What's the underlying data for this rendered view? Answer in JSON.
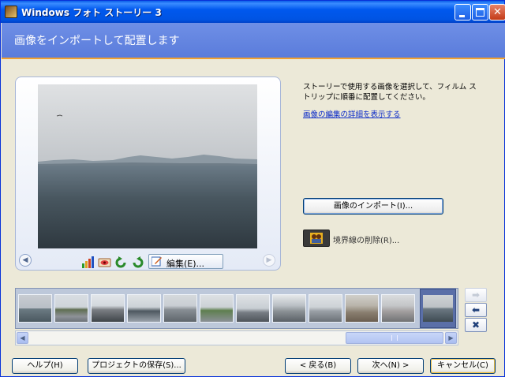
{
  "window": {
    "title": "Windows フォト ストーリー 3"
  },
  "header": {
    "title": "画像をインポートして配置します"
  },
  "preview": {
    "nav_left": "◀",
    "nav_right": "▶",
    "edit_label": "編集(E)..."
  },
  "right_pane": {
    "instruction": "ストーリーで使用する画像を選択して、フィルム ストリップに順番に配置してください。",
    "details_link": "画像の編集の詳細を表示する",
    "import_button": "画像のインポート(I)...",
    "remove_borders": "境界線の削除(R)..."
  },
  "filmstrip": {
    "thumbnails": [
      "photo-1",
      "photo-2",
      "photo-3",
      "photo-4",
      "photo-5",
      "photo-6",
      "photo-7",
      "photo-8",
      "photo-9",
      "photo-10",
      "photo-11",
      "photo-12",
      "photo-13"
    ],
    "selected_index": 12,
    "side_buttons": {
      "right": "➡",
      "left": "⬅",
      "remove": "✖"
    }
  },
  "footer": {
    "help": "ヘルプ(H)",
    "save_project": "プロジェクトの保存(S)...",
    "back": "< 戻る(B)",
    "next": "次へ(N) >",
    "cancel": "キャンセル(C)"
  },
  "colors": {
    "titlebar": "#0054e3",
    "header": "#6484dd",
    "accent_line": "#f0a032",
    "link": "#0a2ac8"
  }
}
